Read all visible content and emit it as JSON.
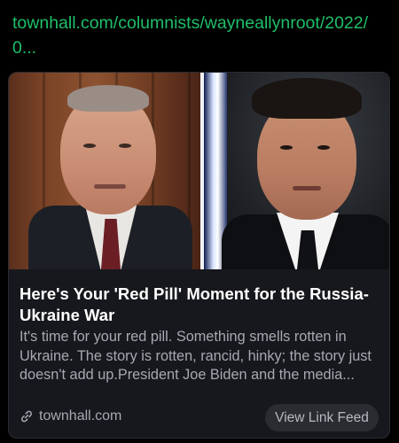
{
  "link": {
    "url": "townhall.com/columnists/wayneallynroot/2022/0..."
  },
  "card": {
    "headline": "Here's Your 'Red Pill' Moment for the Russia-Ukraine War",
    "description": "It's time for your red pill. Something smells rotten in Ukraine. The story is rotten, rancid, hinky; the story just doesn't add up.President Joe Biden and the media...",
    "domain": "townhall.com",
    "feed_button_label": "View Link Feed",
    "icons": {
      "domain": "link-icon"
    }
  },
  "colors": {
    "background": "#000000",
    "url": "#1fbf6a",
    "card_background": "#17181d",
    "headline": "#ffffff",
    "muted_text": "#a8a8b0",
    "button_background": "#2a2c32"
  }
}
